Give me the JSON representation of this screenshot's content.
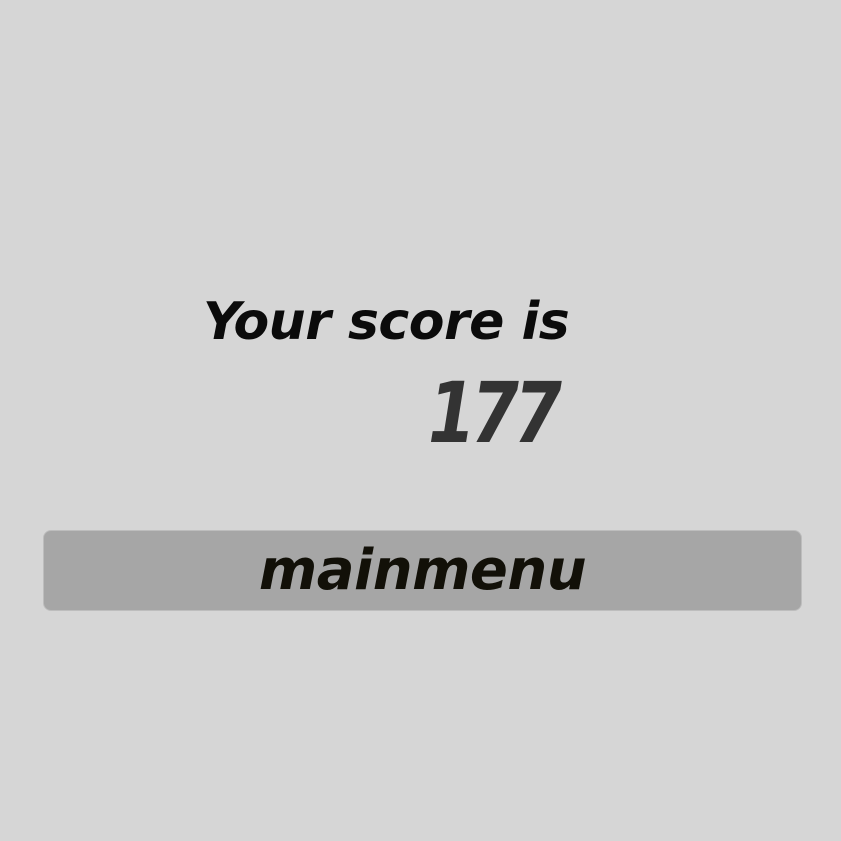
{
  "score_screen": {
    "label": "Your score is",
    "score": "177"
  },
  "menu_button": {
    "label": "mainmenu"
  },
  "colors": {
    "background": "#d6d6d6",
    "button_fill": "#a6a6a6",
    "label_text": "#0b0b0b",
    "score_text": "#333333"
  }
}
